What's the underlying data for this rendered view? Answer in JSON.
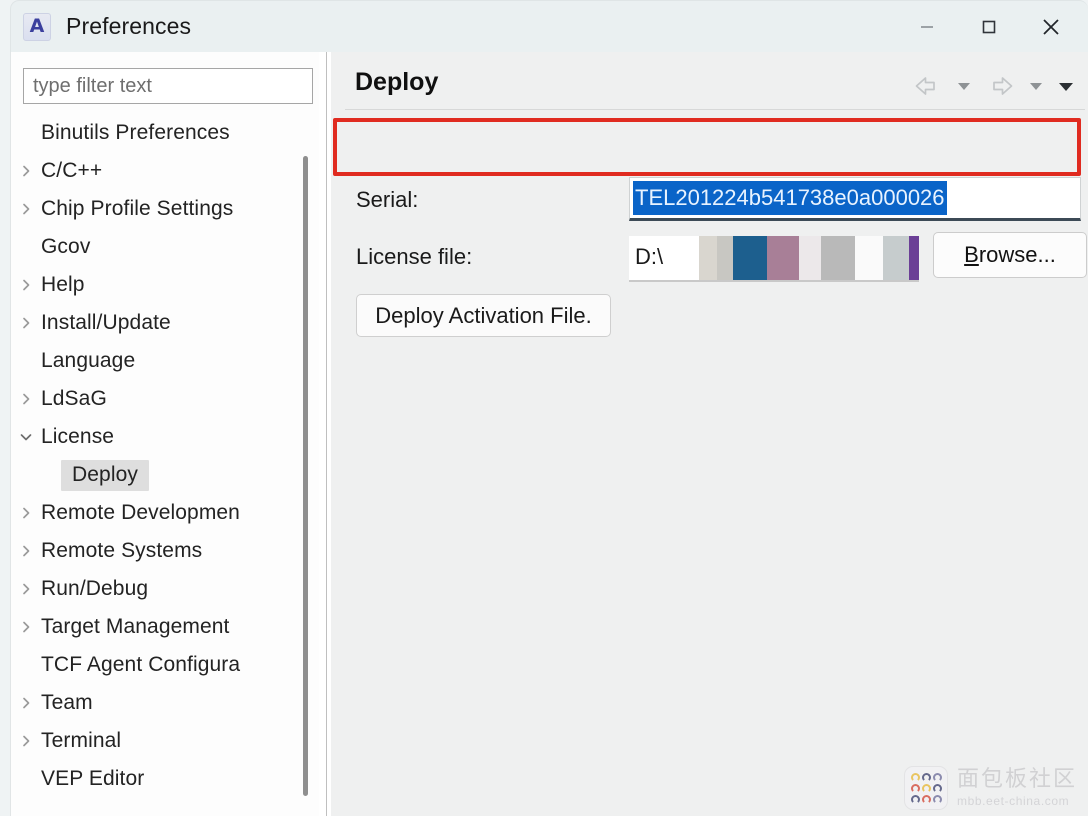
{
  "window": {
    "title": "Preferences",
    "app_icon": "A",
    "controls": [
      {
        "name": "minimize",
        "glyph": "minimize-icon"
      },
      {
        "name": "maximize",
        "glyph": "maximize-icon"
      },
      {
        "name": "close",
        "glyph": "close-icon"
      }
    ]
  },
  "sidebar": {
    "filter": {
      "value": "",
      "placeholder": "type filter text"
    },
    "items": [
      {
        "label": "Binutils Preferences",
        "expandable": false,
        "expanded": false,
        "depth": 1,
        "selected": false
      },
      {
        "label": "C/C++",
        "expandable": true,
        "expanded": false,
        "depth": 1,
        "selected": false
      },
      {
        "label": "Chip Profile Settings",
        "expandable": true,
        "expanded": false,
        "depth": 1,
        "selected": false
      },
      {
        "label": "Gcov",
        "expandable": false,
        "expanded": false,
        "depth": 1,
        "selected": false
      },
      {
        "label": "Help",
        "expandable": true,
        "expanded": false,
        "depth": 1,
        "selected": false
      },
      {
        "label": "Install/Update",
        "expandable": true,
        "expanded": false,
        "depth": 1,
        "selected": false
      },
      {
        "label": "Language",
        "expandable": false,
        "expanded": false,
        "depth": 1,
        "selected": false
      },
      {
        "label": "LdSaG",
        "expandable": true,
        "expanded": false,
        "depth": 1,
        "selected": false
      },
      {
        "label": "License",
        "expandable": true,
        "expanded": true,
        "depth": 1,
        "selected": false
      },
      {
        "label": "Deploy",
        "expandable": false,
        "expanded": false,
        "depth": 2,
        "selected": true
      },
      {
        "label": "Remote Developmen",
        "expandable": true,
        "expanded": false,
        "depth": 1,
        "selected": false
      },
      {
        "label": "Remote Systems",
        "expandable": true,
        "expanded": false,
        "depth": 1,
        "selected": false
      },
      {
        "label": "Run/Debug",
        "expandable": true,
        "expanded": false,
        "depth": 1,
        "selected": false
      },
      {
        "label": "Target Management",
        "expandable": true,
        "expanded": false,
        "depth": 1,
        "selected": false
      },
      {
        "label": "TCF Agent Configura",
        "expandable": false,
        "expanded": false,
        "depth": 1,
        "selected": false
      },
      {
        "label": "Team",
        "expandable": true,
        "expanded": false,
        "depth": 1,
        "selected": false
      },
      {
        "label": "Terminal",
        "expandable": true,
        "expanded": false,
        "depth": 1,
        "selected": false
      },
      {
        "label": "VEP Editor",
        "expandable": false,
        "expanded": false,
        "depth": 1,
        "selected": false
      }
    ]
  },
  "content": {
    "title": "Deploy",
    "nav": [
      {
        "name": "back-arrow-icon"
      },
      {
        "name": "back-dropdown-caret-icon"
      },
      {
        "name": "forward-arrow-icon"
      },
      {
        "name": "forward-dropdown-caret-icon"
      },
      {
        "name": "menu-caret-icon"
      }
    ],
    "serial": {
      "label": "Serial:",
      "value": "TEL201224b541738e0a000026",
      "selected": true,
      "selection_color": "#0a64c8"
    },
    "license_file": {
      "label": "License file:",
      "value": "D:\\",
      "redacted": true
    },
    "browse_button": {
      "label": "Browse...",
      "mnemonic": "B"
    },
    "deploy_button": {
      "label": "Deploy Activation File."
    }
  },
  "annotation": {
    "highlight_color": "#e02b20",
    "target": "serial-row"
  },
  "watermark": {
    "name_cn": "面包板社区",
    "url": "mbb.eet-china.com"
  }
}
